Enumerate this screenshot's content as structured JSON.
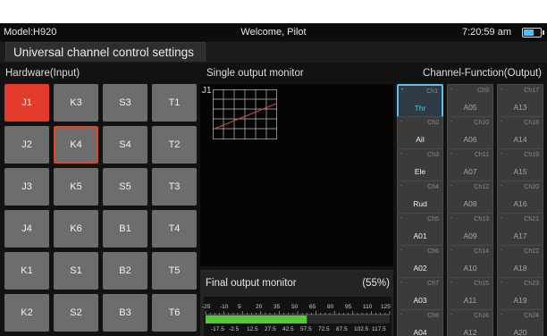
{
  "status": {
    "model": "Model:H920",
    "welcome": "Welcome, Pilot",
    "time": "7:20:59 am",
    "battery_icon": "battery-icon",
    "battery_level": 0.6
  },
  "title": "Universal channel control settings",
  "headers": {
    "hardware": "Hardware(Input)",
    "monitor": "Single output monitor",
    "channels": "Channel-Function(Output)"
  },
  "hardware": {
    "active": "J1",
    "selected": "K4",
    "rows": [
      [
        "J1",
        "K3",
        "S3",
        "T1"
      ],
      [
        "J2",
        "K4",
        "S4",
        "T2"
      ],
      [
        "J3",
        "K5",
        "S5",
        "T3"
      ],
      [
        "J4",
        "K6",
        "B1",
        "T4"
      ],
      [
        "K1",
        "S1",
        "B2",
        "T5"
      ],
      [
        "K2",
        "S2",
        "B3",
        "T6"
      ]
    ]
  },
  "monitor": {
    "label": "J1"
  },
  "final_output": {
    "title": "Final output monitor",
    "percent_text": "(55%)",
    "level": 0.55,
    "top_scale": [
      "-25",
      "-10",
      "5",
      "20",
      "35",
      "50",
      "65",
      "80",
      "95",
      "110",
      "125"
    ],
    "bottom_scale": [
      "-17.5",
      "-2.5",
      "12.5",
      "27.5",
      "42.5",
      "57.5",
      "72.5",
      "87.5",
      "102.5",
      "117.5"
    ]
  },
  "channels": {
    "selected": "Ch1",
    "columns": [
      [
        {
          "ch": "Ch1",
          "fn": "Thr"
        },
        {
          "ch": "Ch2",
          "fn": "Ail"
        },
        {
          "ch": "Ch3",
          "fn": "Ele"
        },
        {
          "ch": "Ch4",
          "fn": "Rud"
        },
        {
          "ch": "Ch5",
          "fn": "A01"
        },
        {
          "ch": "Ch6",
          "fn": "A02"
        },
        {
          "ch": "Ch7",
          "fn": "A03"
        },
        {
          "ch": "Ch8",
          "fn": "A04"
        }
      ],
      [
        {
          "ch": "Ch9",
          "fn": "A05"
        },
        {
          "ch": "Ch10",
          "fn": "A06"
        },
        {
          "ch": "Ch11",
          "fn": "A07"
        },
        {
          "ch": "Ch12",
          "fn": "A08"
        },
        {
          "ch": "Ch13",
          "fn": "A09"
        },
        {
          "ch": "Ch14",
          "fn": "A10"
        },
        {
          "ch": "Ch15",
          "fn": "A11"
        },
        {
          "ch": "Ch16",
          "fn": "A12"
        }
      ],
      [
        {
          "ch": "Ch17",
          "fn": "A13"
        },
        {
          "ch": "Ch18",
          "fn": "A14"
        },
        {
          "ch": "Ch19",
          "fn": "A15"
        },
        {
          "ch": "Ch20",
          "fn": "A16"
        },
        {
          "ch": "Ch21",
          "fn": "A17"
        },
        {
          "ch": "Ch22",
          "fn": "A18"
        },
        {
          "ch": "Ch23",
          "fn": "A19"
        },
        {
          "ch": "Ch24",
          "fn": "A20"
        }
      ]
    ]
  },
  "colors": {
    "active_input": "#e23b2b",
    "selected_border": "#e2481f",
    "channel_selected": "#58c3ef",
    "meter_fill": "#55c83a",
    "curve": "#e04848"
  }
}
